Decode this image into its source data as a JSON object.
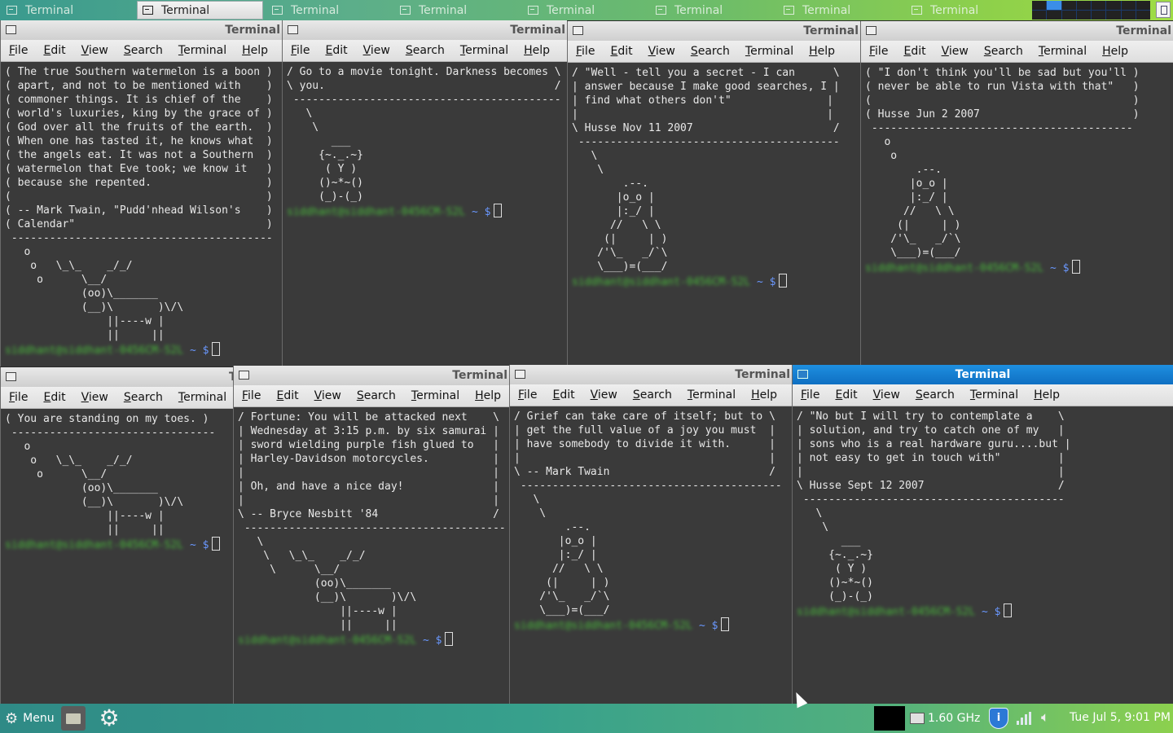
{
  "taskbar": {
    "tasks": [
      {
        "label": "Terminal"
      },
      {
        "label": "Terminal"
      },
      {
        "label": "Terminal"
      },
      {
        "label": "Terminal"
      },
      {
        "label": "Terminal"
      },
      {
        "label": "Terminal"
      },
      {
        "label": "Terminal"
      },
      {
        "label": "Terminal"
      }
    ],
    "active_task_index": 1,
    "workspace_count": 16,
    "current_workspace": 1
  },
  "menu_items": [
    "File",
    "Edit",
    "View",
    "Search",
    "Terminal",
    "Help"
  ],
  "prompt": {
    "user": "siddhant@siddhant-0456CM-S2L",
    "path": "~ $"
  },
  "windows": [
    {
      "title": "Terminal",
      "text": "( The true Southern watermelon is a boon )\n( apart, and not to be mentioned with    )\n( commoner things. It is chief of the    )\n( world's luxuries, king by the grace of )\n( God over all the fruits of the earth.  )\n( When one has tasted it, he knows what  )\n( the angels eat. It was not a Southern  )\n( watermelon that Eve took; we know it   )\n( because she repented.                  )\n(                                        )\n( -- Mark Twain, \"Pudd'nhead Wilson's    )\n( Calendar\"                              )\n -----------------------------------------\n   o\n    o   \\_\\_    _/_/\n     o      \\__/\n            (oo)\\_______\n            (__)\\       )\\/\\\n                ||----w |\n                ||     ||"
    },
    {
      "title": "Terminal",
      "text": "/ Go to a movie tonight. Darkness becomes \\\n\\ you.                                    /\n ------------------------------------------\n   \\\n    \\\n       ___\n     {~._.~}\n      ( Y )\n     ()~*~()\n     (_)-(_)"
    },
    {
      "title": "Terminal",
      "text": "/ \"Well - tell you a secret - I can      \\\n| answer because I make good searches, I |\n| find what others don't\"               |\n|                                       |\n\\ Husse Nov 11 2007                      /\n -----------------------------------------\n   \\\n    \\\n        .--.\n       |o_o |\n       |:_/ |\n      //   \\ \\\n     (|     | )\n    /'\\_   _/`\\\n    \\___)=(___/"
    },
    {
      "title": "Terminal",
      "text": "( \"I don't think you'll be sad but you'll )\n( never be able to run Vista with that\"   )\n(                                         )\n( Husse Jun 2 2007                        )\n -----------------------------------------\n   o\n    o\n        .--.\n       |o_o |\n       |:_/ |\n      //   \\ \\\n     (|     | )\n    /'\\_   _/`\\\n    \\___)=(___/"
    },
    {
      "title": "Terminal",
      "text": "( You are standing on my toes. )\n --------------------------------\n   o\n    o   \\_\\_    _/_/\n     o      \\__/\n            (oo)\\_______\n            (__)\\       )\\/\\\n                ||----w |\n                ||     ||"
    },
    {
      "title": "Terminal",
      "text": "/ Fortune: You will be attacked next    \\\n| Wednesday at 3:15 p.m. by six samurai |\n| sword wielding purple fish glued to   |\n| Harley-Davidson motorcycles.          |\n|                                       |\n| Oh, and have a nice day!              |\n|                                       |\n\\ -- Bryce Nesbitt '84                  /\n -----------------------------------------\n   \\\n    \\   \\_\\_    _/_/\n     \\      \\__/\n            (oo)\\_______\n            (__)\\       )\\/\\\n                ||----w |\n                ||     ||"
    },
    {
      "title": "Terminal",
      "text": "/ Grief can take care of itself; but to \\\n| get the full value of a joy you must  |\n| have somebody to divide it with.      |\n|                                       |\n\\ -- Mark Twain                         /\n -----------------------------------------\n   \\\n    \\\n        .--.\n       |o_o |\n       |:_/ |\n      //   \\ \\\n     (|     | )\n    /'\\_   _/`\\\n    \\___)=(___/"
    },
    {
      "title": "Terminal",
      "text": "/ \"No but I will try to contemplate a    \\\n| solution, and try to catch one of my   |\n| sons who is a real hardware guru....but |\n| not easy to get in touch with\"         |\n|                                        |\n\\ Husse Sept 12 2007                     /\n -----------------------------------------\n   \\\n    \\\n       ___\n     {~._.~}\n      ( Y )\n     ()~*~()\n     (_)-(_)"
    }
  ],
  "panel": {
    "menu_label": "Menu",
    "cpu_freq": "1.60 GHz",
    "shield_glyph": "i",
    "clock": "Tue Jul  5,  9:01 PM"
  }
}
